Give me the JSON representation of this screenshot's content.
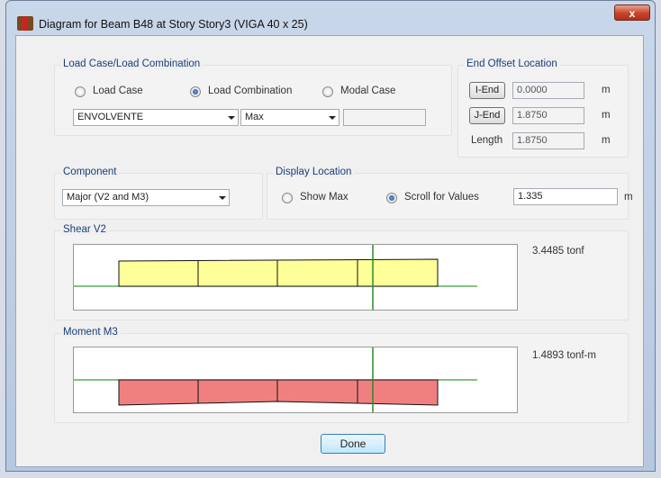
{
  "window": {
    "title": "Diagram for Beam B48 at Story Story3 (VIGA 40 x 25)",
    "close_label": "x"
  },
  "load_case": {
    "group_title": "Load Case/Load Combination",
    "options": [
      "Load Case",
      "Load Combination",
      "Modal Case"
    ],
    "selected": "Load Combination",
    "combo_value": "ENVOLVENTE",
    "type_value": "Max",
    "extra_value": ""
  },
  "end_offset": {
    "group_title": "End Offset Location",
    "i_end_label": "I-End",
    "i_end_value": "0.0000",
    "i_end_unit": "m",
    "j_end_label": "J-End",
    "j_end_value": "1.8750",
    "j_end_unit": "m",
    "length_label": "Length",
    "length_value": "1.8750",
    "length_unit": "m"
  },
  "component": {
    "group_title": "Component",
    "value": "Major (V2 and M3)"
  },
  "display_location": {
    "group_title": "Display Location",
    "show_max_label": "Show Max",
    "scroll_label": "Scroll for Values",
    "selected": "Scroll for Values",
    "value": "1.335",
    "unit": "m"
  },
  "shear": {
    "group_title": "Shear V2",
    "value_text": "3.4485 tonf",
    "fill_color": "#ffff99"
  },
  "moment": {
    "group_title": "Moment M3",
    "value_text": "1.4893 tonf-m",
    "fill_color": "#f08080"
  },
  "done_label": "Done"
}
